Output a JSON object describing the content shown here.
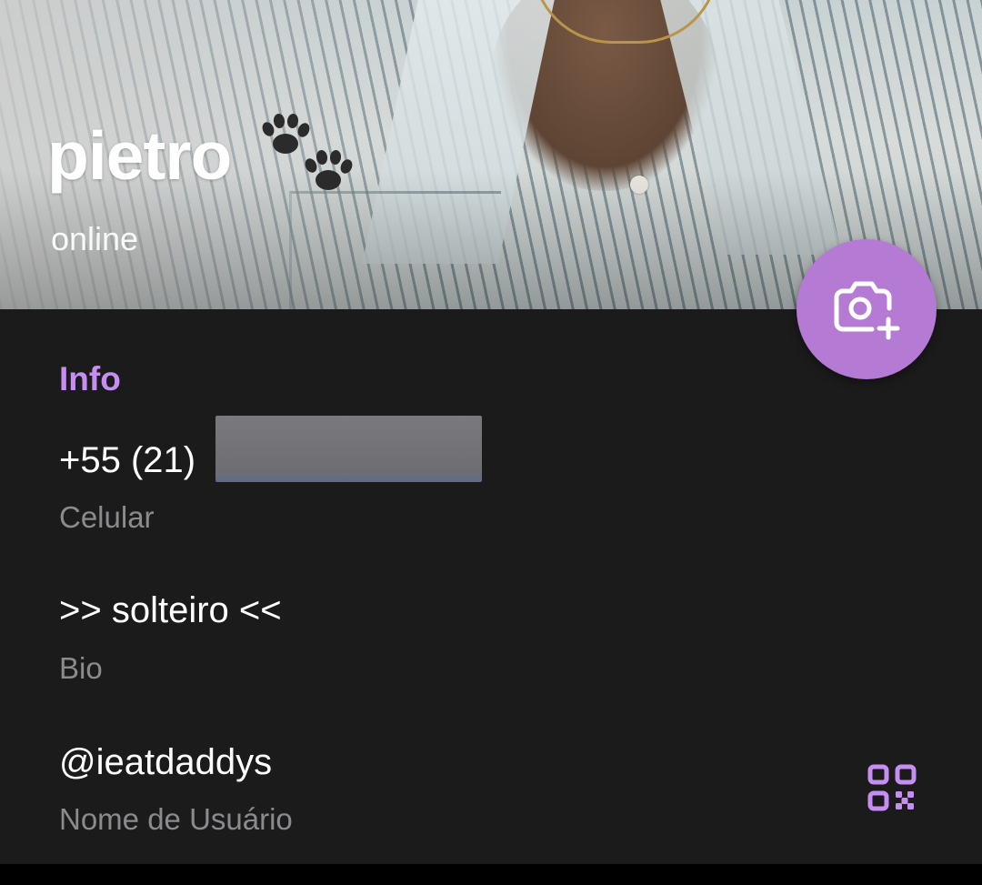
{
  "profile": {
    "name": "pietro",
    "name_emoji": "paw-prints",
    "status": "online"
  },
  "fab": {
    "icon": "add-photo-icon",
    "color": "#b57ad3"
  },
  "info": {
    "section_title": "Info",
    "accent_color": "#c58ef0",
    "phone": {
      "value": "+55 (21)",
      "label": "Celular",
      "redacted": true
    },
    "bio": {
      "value": ">> solteiro <<",
      "label": "Bio"
    },
    "username": {
      "value": "@ieatdaddys",
      "label": "Nome de Usuário",
      "action_icon": "qr-code-icon"
    }
  },
  "theme": {
    "background": "#1b1b1c",
    "text_primary": "#ffffff",
    "text_secondary": "#8b8b8e"
  }
}
